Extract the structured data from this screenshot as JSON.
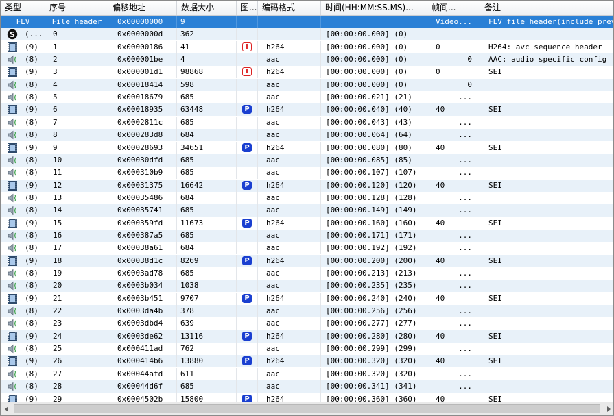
{
  "columns": [
    {
      "key": "type",
      "label": "类型"
    },
    {
      "key": "index",
      "label": "序号"
    },
    {
      "key": "offset",
      "label": "偏移地址"
    },
    {
      "key": "size",
      "label": "数据大小"
    },
    {
      "key": "frame",
      "label": "图..."
    },
    {
      "key": "codec",
      "label": "编码格式"
    },
    {
      "key": "time",
      "label": "时间(HH:MM:SS.MS)..."
    },
    {
      "key": "interval",
      "label": "帧间..."
    },
    {
      "key": "note",
      "label": "备注"
    }
  ],
  "rows": [
    {
      "icon": "flv",
      "type": "FLV",
      "index": "File header",
      "offset": "0x00000000",
      "size": "9",
      "frame": "",
      "codec": "",
      "time": "",
      "interval": "Video...",
      "note": "FLV file header(include prev",
      "selected": true
    },
    {
      "icon": "script",
      "type": "(...",
      "index": "0",
      "offset": "0x0000000d",
      "size": "362",
      "frame": "",
      "codec": "",
      "time": "[00:00:00.000] (0)",
      "interval": "",
      "note": ""
    },
    {
      "icon": "video",
      "type": "(9)",
      "index": "1",
      "offset": "0x00000186",
      "size": "41",
      "frame": "I",
      "codec": "h264",
      "time": "[00:00:00.000] (0)",
      "interval": "0",
      "note": "H264: avc sequence header"
    },
    {
      "icon": "audio",
      "type": "(8)",
      "index": "2",
      "offset": "0x000001be",
      "size": "4",
      "frame": "",
      "codec": "aac",
      "time": "[00:00:00.000] (0)",
      "interval": "0",
      "intervalRight": true,
      "note": "AAC: audio specific config"
    },
    {
      "icon": "video",
      "type": "(9)",
      "index": "3",
      "offset": "0x000001d1",
      "size": "98868",
      "frame": "I",
      "codec": "h264",
      "time": "[00:00:00.000] (0)",
      "interval": "0",
      "note": "SEI"
    },
    {
      "icon": "audio",
      "type": "(8)",
      "index": "4",
      "offset": "0x00018414",
      "size": "598",
      "frame": "",
      "codec": "aac",
      "time": "[00:00:00.000] (0)",
      "interval": "0",
      "intervalRight": true,
      "note": ""
    },
    {
      "icon": "audio",
      "type": "(8)",
      "index": "5",
      "offset": "0x00018679",
      "size": "685",
      "frame": "",
      "codec": "aac",
      "time": "[00:00:00.021] (21)",
      "interval": "...",
      "intervalRight": true,
      "note": ""
    },
    {
      "icon": "video",
      "type": "(9)",
      "index": "6",
      "offset": "0x00018935",
      "size": "63448",
      "frame": "P",
      "codec": "h264",
      "time": "[00:00:00.040] (40)",
      "interval": "40",
      "note": "SEI"
    },
    {
      "icon": "audio",
      "type": "(8)",
      "index": "7",
      "offset": "0x0002811c",
      "size": "685",
      "frame": "",
      "codec": "aac",
      "time": "[00:00:00.043] (43)",
      "interval": "...",
      "intervalRight": true,
      "note": ""
    },
    {
      "icon": "audio",
      "type": "(8)",
      "index": "8",
      "offset": "0x000283d8",
      "size": "684",
      "frame": "",
      "codec": "aac",
      "time": "[00:00:00.064] (64)",
      "interval": "...",
      "intervalRight": true,
      "note": ""
    },
    {
      "icon": "video",
      "type": "(9)",
      "index": "9",
      "offset": "0x00028693",
      "size": "34651",
      "frame": "P",
      "codec": "h264",
      "time": "[00:00:00.080] (80)",
      "interval": "40",
      "note": "SEI"
    },
    {
      "icon": "audio",
      "type": "(8)",
      "index": "10",
      "offset": "0x00030dfd",
      "size": "685",
      "frame": "",
      "codec": "aac",
      "time": "[00:00:00.085] (85)",
      "interval": "...",
      "intervalRight": true,
      "note": ""
    },
    {
      "icon": "audio",
      "type": "(8)",
      "index": "11",
      "offset": "0x000310b9",
      "size": "685",
      "frame": "",
      "codec": "aac",
      "time": "[00:00:00.107] (107)",
      "interval": "...",
      "intervalRight": true,
      "note": ""
    },
    {
      "icon": "video",
      "type": "(9)",
      "index": "12",
      "offset": "0x00031375",
      "size": "16642",
      "frame": "P",
      "codec": "h264",
      "time": "[00:00:00.120] (120)",
      "interval": "40",
      "note": "SEI"
    },
    {
      "icon": "audio",
      "type": "(8)",
      "index": "13",
      "offset": "0x00035486",
      "size": "684",
      "frame": "",
      "codec": "aac",
      "time": "[00:00:00.128] (128)",
      "interval": "...",
      "intervalRight": true,
      "note": ""
    },
    {
      "icon": "audio",
      "type": "(8)",
      "index": "14",
      "offset": "0x00035741",
      "size": "685",
      "frame": "",
      "codec": "aac",
      "time": "[00:00:00.149] (149)",
      "interval": "...",
      "intervalRight": true,
      "note": ""
    },
    {
      "icon": "video",
      "type": "(9)",
      "index": "15",
      "offset": "0x000359fd",
      "size": "11673",
      "frame": "P",
      "codec": "h264",
      "time": "[00:00:00.160] (160)",
      "interval": "40",
      "note": "SEI"
    },
    {
      "icon": "audio",
      "type": "(8)",
      "index": "16",
      "offset": "0x000387a5",
      "size": "685",
      "frame": "",
      "codec": "aac",
      "time": "[00:00:00.171] (171)",
      "interval": "...",
      "intervalRight": true,
      "note": ""
    },
    {
      "icon": "audio",
      "type": "(8)",
      "index": "17",
      "offset": "0x00038a61",
      "size": "684",
      "frame": "",
      "codec": "aac",
      "time": "[00:00:00.192] (192)",
      "interval": "...",
      "intervalRight": true,
      "note": ""
    },
    {
      "icon": "video",
      "type": "(9)",
      "index": "18",
      "offset": "0x00038d1c",
      "size": "8269",
      "frame": "P",
      "codec": "h264",
      "time": "[00:00:00.200] (200)",
      "interval": "40",
      "note": "SEI"
    },
    {
      "icon": "audio",
      "type": "(8)",
      "index": "19",
      "offset": "0x0003ad78",
      "size": "685",
      "frame": "",
      "codec": "aac",
      "time": "[00:00:00.213] (213)",
      "interval": "...",
      "intervalRight": true,
      "note": ""
    },
    {
      "icon": "audio",
      "type": "(8)",
      "index": "20",
      "offset": "0x0003b034",
      "size": "1038",
      "frame": "",
      "codec": "aac",
      "time": "[00:00:00.235] (235)",
      "interval": "...",
      "intervalRight": true,
      "note": ""
    },
    {
      "icon": "video",
      "type": "(9)",
      "index": "21",
      "offset": "0x0003b451",
      "size": "9707",
      "frame": "P",
      "codec": "h264",
      "time": "[00:00:00.240] (240)",
      "interval": "40",
      "note": "SEI"
    },
    {
      "icon": "audio",
      "type": "(8)",
      "index": "22",
      "offset": "0x0003da4b",
      "size": "378",
      "frame": "",
      "codec": "aac",
      "time": "[00:00:00.256] (256)",
      "interval": "...",
      "intervalRight": true,
      "note": ""
    },
    {
      "icon": "audio",
      "type": "(8)",
      "index": "23",
      "offset": "0x0003dbd4",
      "size": "639",
      "frame": "",
      "codec": "aac",
      "time": "[00:00:00.277] (277)",
      "interval": "...",
      "intervalRight": true,
      "note": ""
    },
    {
      "icon": "video",
      "type": "(9)",
      "index": "24",
      "offset": "0x0003de62",
      "size": "13116",
      "frame": "P",
      "codec": "h264",
      "time": "[00:00:00.280] (280)",
      "interval": "40",
      "note": "SEI"
    },
    {
      "icon": "audio",
      "type": "(8)",
      "index": "25",
      "offset": "0x000411ad",
      "size": "762",
      "frame": "",
      "codec": "aac",
      "time": "[00:00:00.299] (299)",
      "interval": "...",
      "intervalRight": true,
      "note": ""
    },
    {
      "icon": "video",
      "type": "(9)",
      "index": "26",
      "offset": "0x000414b6",
      "size": "13880",
      "frame": "P",
      "codec": "h264",
      "time": "[00:00:00.320] (320)",
      "interval": "40",
      "note": "SEI"
    },
    {
      "icon": "audio",
      "type": "(8)",
      "index": "27",
      "offset": "0x00044afd",
      "size": "611",
      "frame": "",
      "codec": "aac",
      "time": "[00:00:00.320] (320)",
      "interval": "...",
      "intervalRight": true,
      "note": ""
    },
    {
      "icon": "audio",
      "type": "(8)",
      "index": "28",
      "offset": "0x00044d6f",
      "size": "685",
      "frame": "",
      "codec": "aac",
      "time": "[00:00:00.341] (341)",
      "interval": "...",
      "intervalRight": true,
      "note": ""
    },
    {
      "icon": "video",
      "type": "(9)",
      "index": "29",
      "offset": "0x0004502b",
      "size": "15800",
      "frame": "P",
      "codec": "h264",
      "time": "[00:00:00.360] (360)",
      "interval": "40",
      "note": "SEI"
    }
  ],
  "colors": {
    "selected": "#2a80d6",
    "alt_row": "#e8f1f9",
    "i_frame": "#dd2222",
    "p_frame": "#1a3fd0"
  }
}
